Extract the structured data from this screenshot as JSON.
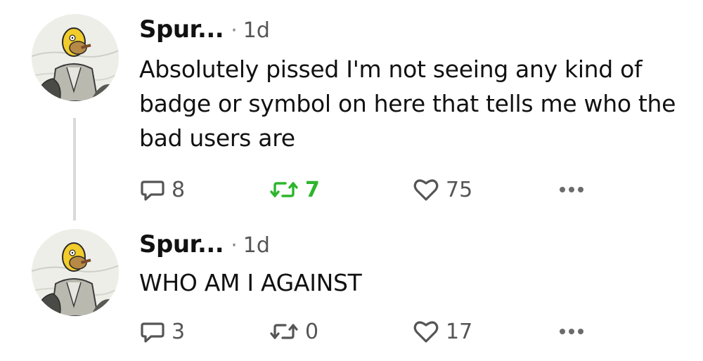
{
  "colors": {
    "text": "#111111",
    "muted": "#555555",
    "repost_active": "#2db52d",
    "thread_line": "#d9d9d9"
  },
  "posts": [
    {
      "author": "Spur...",
      "separator": "·",
      "timestamp": "1d",
      "text": "Absolutely pissed I'm not seeing any kind of badge or symbol on here that tells me who the bad users are",
      "replies": "8",
      "reposts": "7",
      "reposted": true,
      "likes": "75",
      "icons": {
        "avatar": "avatar-cartoon-icon",
        "reply": "reply-bubble-icon",
        "repost": "repost-arrows-icon",
        "like": "heart-icon",
        "more": "more-dots-icon"
      }
    },
    {
      "author": "Spur...",
      "separator": "·",
      "timestamp": "1d",
      "text": "WHO AM I AGAINST",
      "replies": "3",
      "reposts": "0",
      "reposted": false,
      "likes": "17",
      "icons": {
        "avatar": "avatar-cartoon-icon",
        "reply": "reply-bubble-icon",
        "repost": "repost-arrows-icon",
        "like": "heart-icon",
        "more": "more-dots-icon"
      }
    }
  ]
}
